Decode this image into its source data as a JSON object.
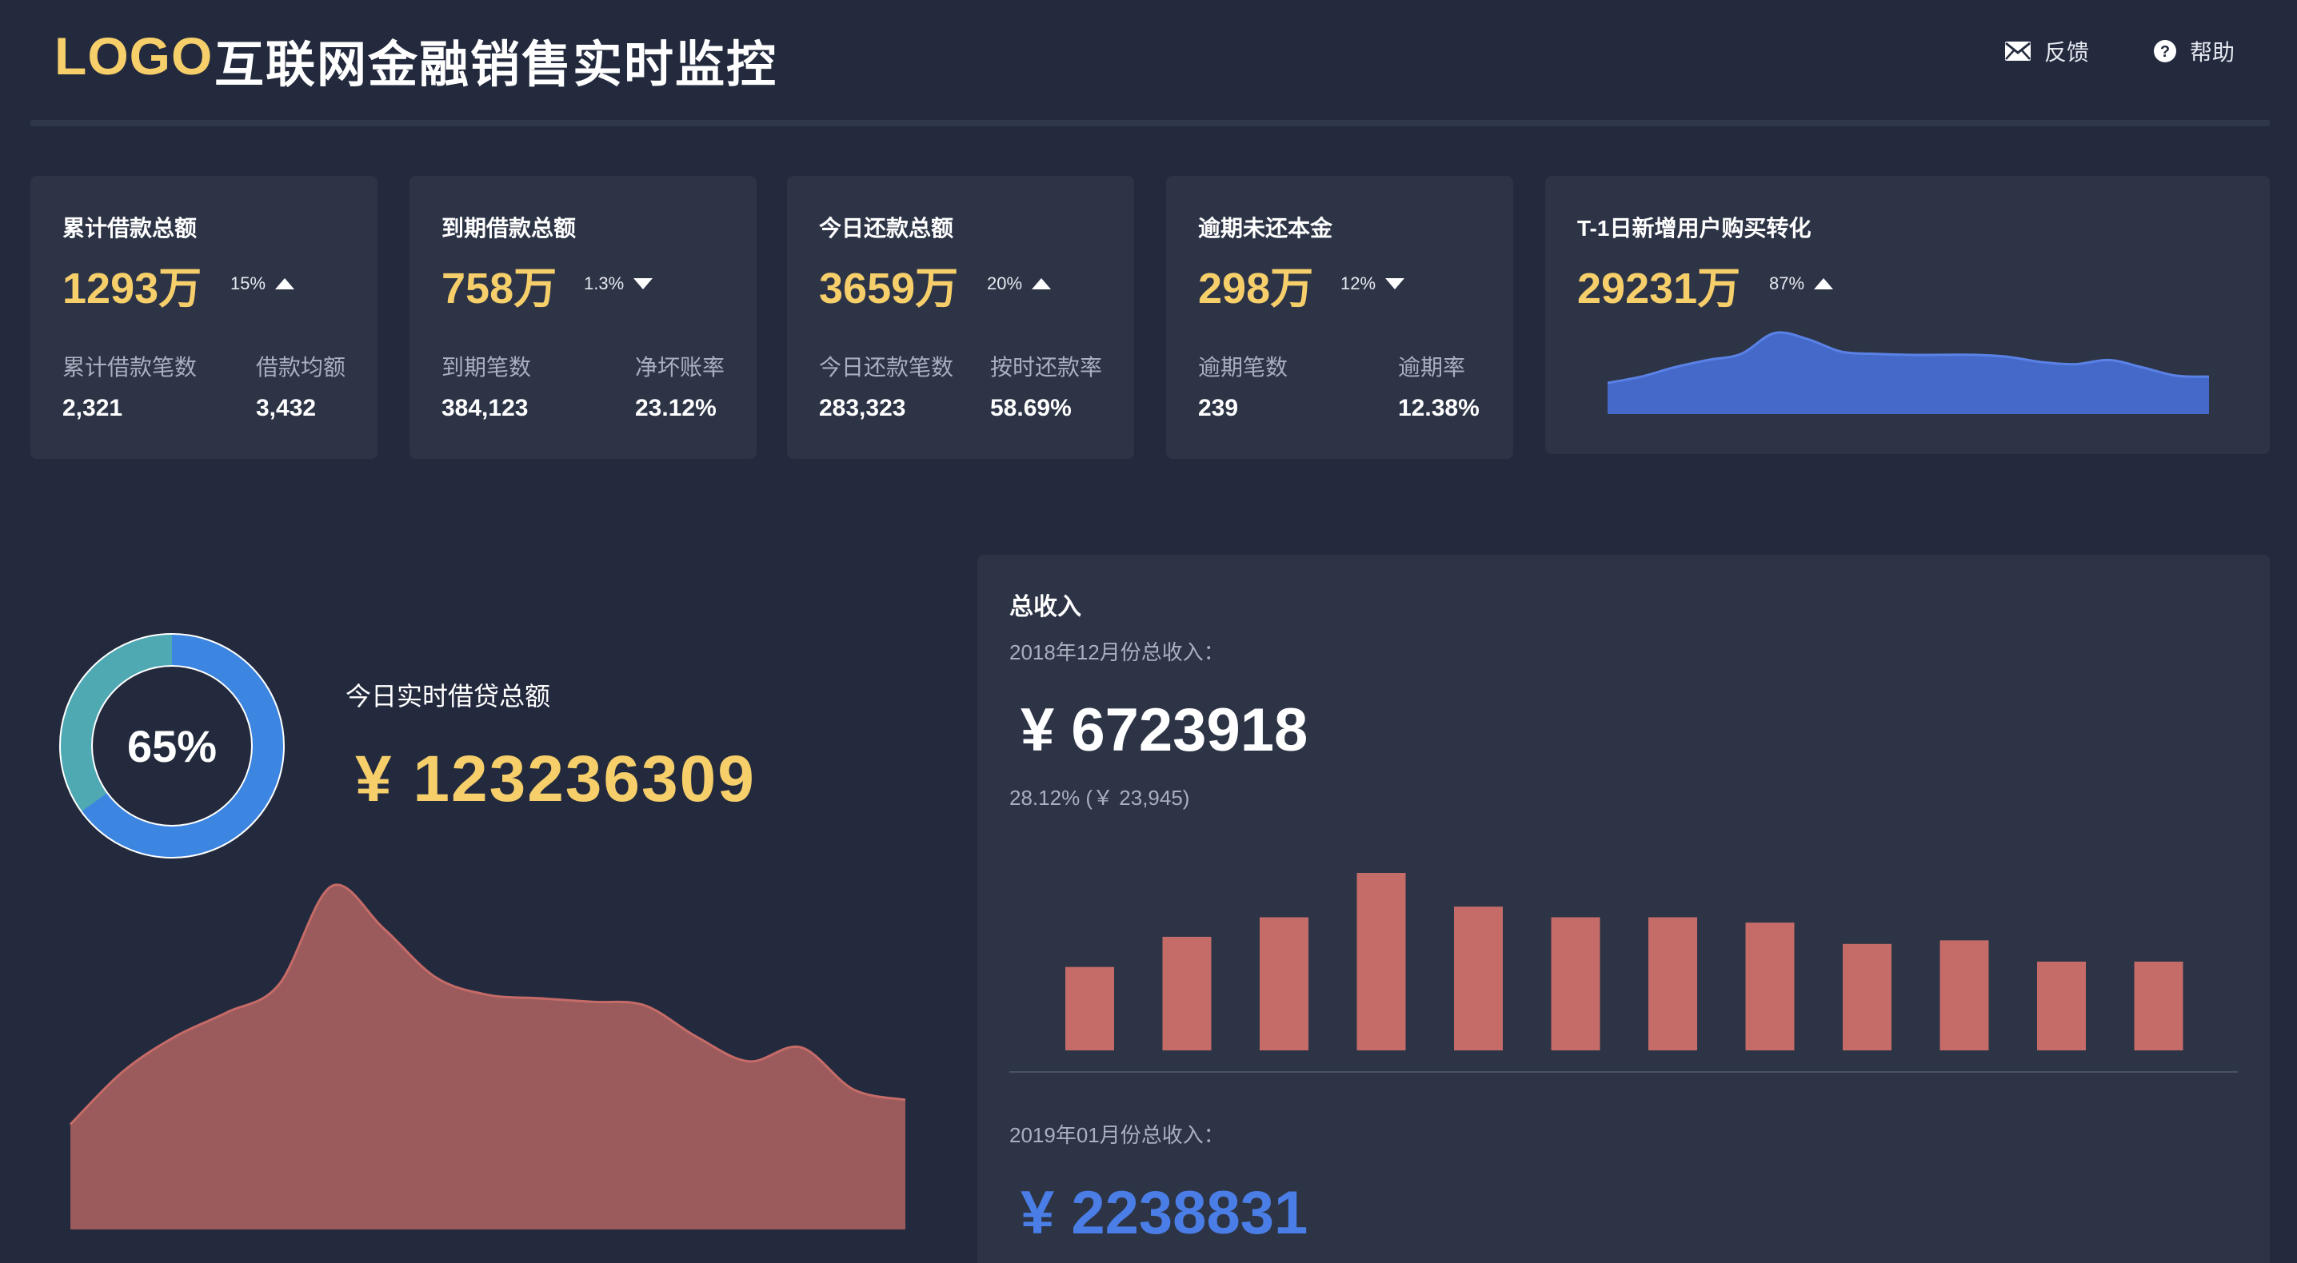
{
  "header": {
    "logo": "LOGO",
    "title": "互联网金融销售实时监控",
    "feedback_label": "反馈",
    "help_label": "帮助"
  },
  "cards": [
    {
      "label": "累计借款总额",
      "value": "1293万",
      "trend_pct": "15%",
      "trend_dir": "up",
      "sub": [
        {
          "label": "累计借款笔数",
          "value": "2,321"
        },
        {
          "label": "借款均额",
          "value": "3,432"
        }
      ]
    },
    {
      "label": "到期借款总额",
      "value": "758万",
      "trend_pct": "1.3%",
      "trend_dir": "down",
      "sub": [
        {
          "label": "到期笔数",
          "value": "384,123"
        },
        {
          "label": "净坏账率",
          "value": "23.12%"
        }
      ]
    },
    {
      "label": "今日还款总额",
      "value": "3659万",
      "trend_pct": "20%",
      "trend_dir": "up",
      "sub": [
        {
          "label": "今日还款笔数",
          "value": "283,323"
        },
        {
          "label": "按时还款率",
          "value": "58.69%"
        }
      ]
    },
    {
      "label": "逾期未还本金",
      "value": "298万",
      "trend_pct": "12%",
      "trend_dir": "down",
      "sub": [
        {
          "label": "逾期笔数",
          "value": "239"
        },
        {
          "label": "逾期率",
          "value": "12.38%"
        }
      ]
    },
    {
      "label": "T-1日新增用户购买转化",
      "value": "29231万",
      "trend_pct": "87%",
      "trend_dir": "up"
    }
  ],
  "realtime": {
    "percent": "65%",
    "percent_value": 0.65,
    "label": "今日实时借贷总额",
    "amount": "¥ 123236309"
  },
  "revenue": {
    "title": "总收入",
    "current_period": "2018年12月份总收入：",
    "current_amount": "¥ 6723918",
    "growth": "28.12% (￥ 23,945)",
    "next_period": "2019年01月份总收入：",
    "next_amount": "¥ 2238831"
  },
  "colors": {
    "background": "#232a3d",
    "card": "#2d3446",
    "accent_yellow": "#f6cf6b",
    "donut_primary": "#3c85e0",
    "donut_secondary": "#4fa9b3",
    "sparkline": "#4569c9",
    "area_red": "#9b5a5c",
    "bar_red": "#c56b68",
    "next_amount_blue": "#4a7ee6"
  },
  "icons": {
    "feedback": "mail-icon",
    "help": "question-circle-icon"
  },
  "chart_data": [
    {
      "type": "area",
      "series": [
        {
          "values": [
            30,
            36,
            45,
            52,
            58,
            78,
            72,
            60,
            58,
            57,
            57,
            57,
            55,
            50,
            48,
            52,
            45,
            37,
            36
          ]
        }
      ],
      "ylim": [
        0,
        100
      ]
    },
    {
      "type": "area",
      "series": [
        {
          "values": [
            30,
            45,
            55,
            62,
            70,
            98,
            86,
            72,
            67,
            66,
            65,
            64,
            55,
            48,
            52,
            40,
            37
          ]
        }
      ],
      "ylim": [
        0,
        100
      ]
    },
    {
      "type": "bar",
      "values": [
        47,
        64,
        75,
        100,
        81,
        75,
        75,
        72,
        60,
        62,
        50,
        50
      ],
      "ylim": [
        0,
        100
      ]
    }
  ]
}
